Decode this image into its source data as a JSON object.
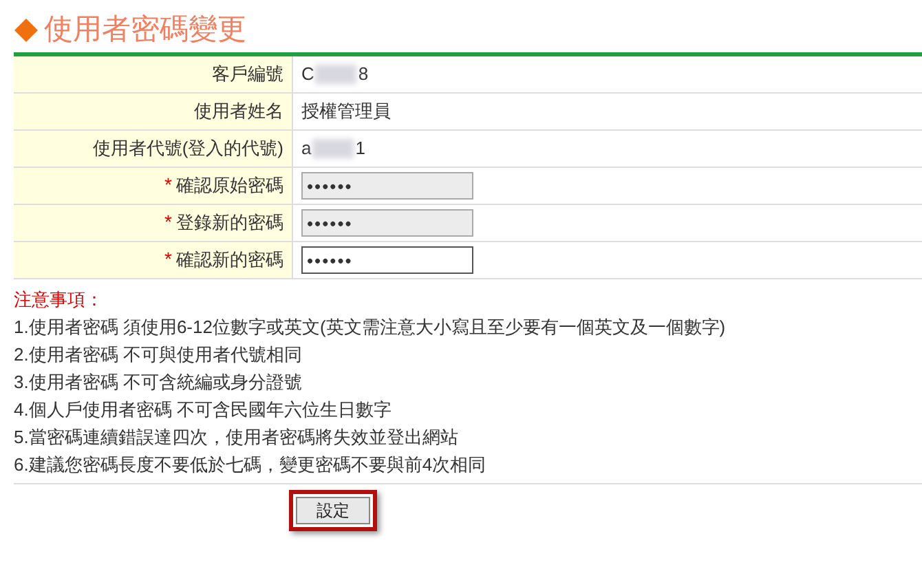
{
  "title": "使用者密碼變更",
  "rows": [
    {
      "kind": "text",
      "label": "客戶編號",
      "value_parts": [
        "C",
        "8"
      ]
    },
    {
      "kind": "text",
      "label": "使用者姓名",
      "value_parts": [
        "授權管理員"
      ]
    },
    {
      "kind": "text",
      "label": "使用者代號(登入的代號)",
      "value_parts": [
        "a",
        "1"
      ]
    },
    {
      "kind": "password",
      "label": "確認原始密碼",
      "required_mark": "*",
      "value": "••••••",
      "disabled": true
    },
    {
      "kind": "password",
      "label": "登錄新的密碼",
      "required_mark": "*",
      "value": "••••••",
      "disabled": true
    },
    {
      "kind": "password",
      "label": "確認新的密碼",
      "required_mark": "*",
      "value": "••••••",
      "disabled": false
    }
  ],
  "notes": {
    "heading": "注意事項：",
    "items": [
      "1.使用者密碼 須使用6-12位數字或英文(英文需注意大小寫且至少要有一個英文及一個數字)",
      "2.使用者密碼 不可與使用者代號相同",
      "3.使用者密碼 不可含統編或身分證號",
      "4.個人戶使用者密碼 不可含民國年六位生日數字",
      "5.當密碼連續錯誤達四次，使用者密碼將失效並登出網站",
      "6.建議您密碼長度不要低於七碼，變更密碼不要與前4次相同"
    ]
  },
  "submit_button": "設定"
}
